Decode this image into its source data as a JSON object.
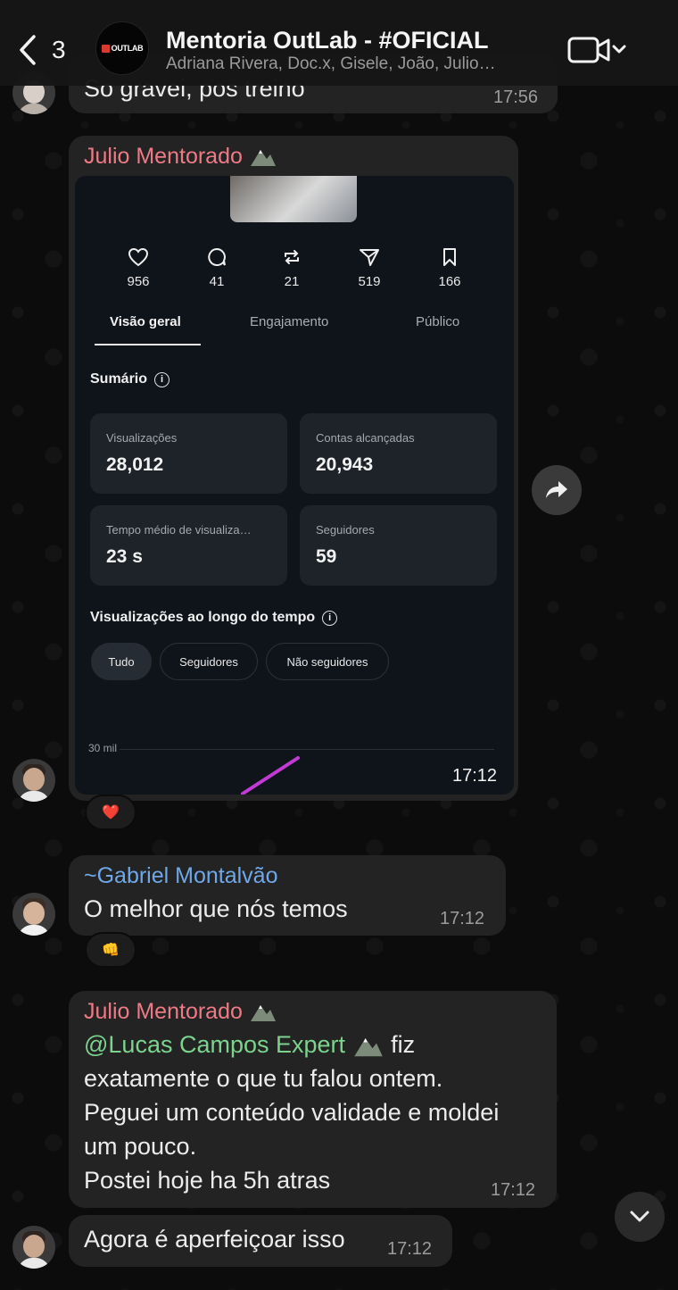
{
  "header": {
    "back_count": "3",
    "logo_text": "OUTLAB",
    "title": "Mentoria OutLab - #OFICIAL",
    "members": "Adriana Rivera, Doc.x, Gisele, João, Julio…"
  },
  "messages": {
    "m0": {
      "text": "So gravei, pos treino",
      "time": "17:56"
    },
    "m1": {
      "sender": "Julio Mentorado",
      "time": "17:12",
      "reaction": "❤️",
      "shot": {
        "metrics": [
          {
            "icon": "heart-icon",
            "value": "956"
          },
          {
            "icon": "comment-icon",
            "value": "41"
          },
          {
            "icon": "repost-icon",
            "value": "21"
          },
          {
            "icon": "share-icon",
            "value": "519"
          },
          {
            "icon": "bookmark-icon",
            "value": "166"
          }
        ],
        "tabs": [
          "Visão geral",
          "Engajamento",
          "Público"
        ],
        "summary_title": "Sumário",
        "cards": [
          {
            "label": "Visualizações",
            "value": "28,012"
          },
          {
            "label": "Contas alcançadas",
            "value": "20,943"
          },
          {
            "label": "Tempo médio de visualiza…",
            "value": "23 s"
          },
          {
            "label": "Seguidores",
            "value": "59"
          }
        ],
        "chart_title": "Visualizações ao longo do tempo",
        "pills": [
          "Tudo",
          "Seguidores",
          "Não seguidores"
        ],
        "axis_label": "30 mil"
      }
    },
    "m2": {
      "sender": "~Gabriel Montalvão",
      "text": "O melhor que nós temos",
      "time": "17:12",
      "reaction": "👊"
    },
    "m3": {
      "sender": "Julio Mentorado",
      "mention": "@Lucas Campos Expert",
      "line1_rest": "fiz",
      "line2": "exatamente o que tu falou ontem.",
      "line3": "Peguei um conteúdo validade e moldei",
      "line4": "um pouco.",
      "line5": "Postei hoje ha 5h atras",
      "time": "17:12"
    },
    "m4": {
      "text": "Agora é aperfeiçoar isso",
      "time": "17:12"
    }
  },
  "colors": {
    "sender_pink": "#ee7a86",
    "sender_blue": "#6fa8e8",
    "mention_green": "#7bd38d",
    "bubble": "#232323"
  }
}
